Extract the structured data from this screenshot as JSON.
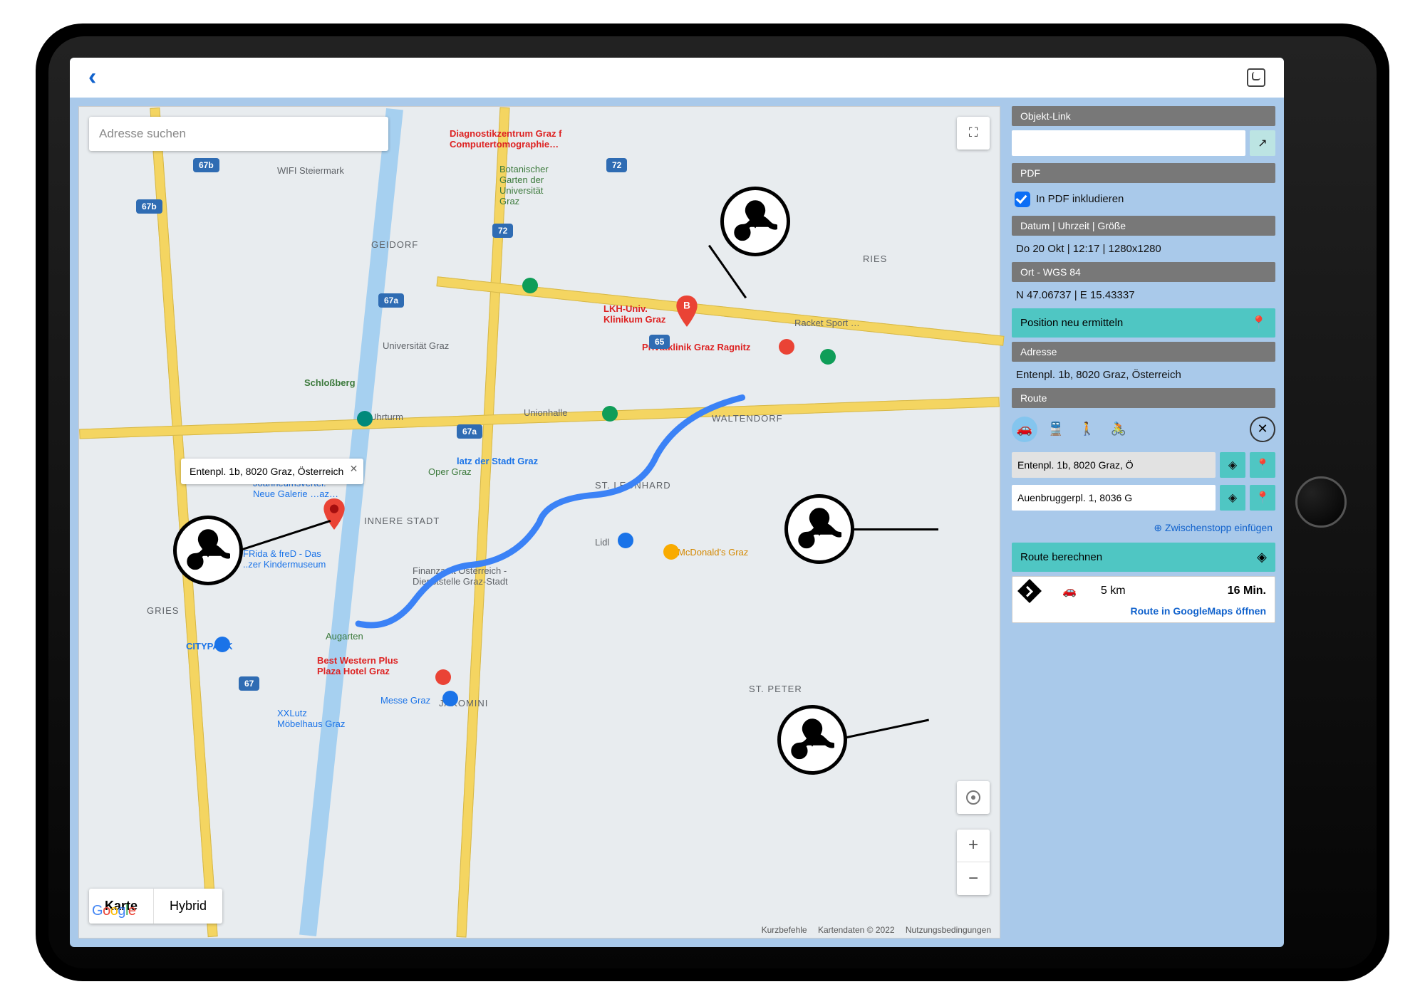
{
  "topbar": {
    "save_tooltip": "Speichern"
  },
  "map": {
    "search_placeholder": "Adresse suchen",
    "type_map": "Karte",
    "type_hybrid": "Hybrid",
    "callout_address": "Entenpl. 1b, 8020 Graz, Österreich",
    "marker_b_label": "B",
    "credits": {
      "shortcuts": "Kurzbefehle",
      "data": "Kartendaten © 2022",
      "terms": "Nutzungsbedingungen"
    },
    "google": "Google",
    "labels": {
      "diag": "Diagnostikzentrum Graz f\nComputertomographie…",
      "wifi": "WIFI Steiermark",
      "botan": "Botanischer\nGarten der\nUniversität\nGraz",
      "lkh": "LKH-Univ.\nKlinikum Graz",
      "privat": "Privatklinik Graz Ragnitz",
      "racket": "Racket Sport …",
      "waltendorf": "WALTENDORF",
      "geidorf": "GEIDORF",
      "ries": "RIES",
      "gries": "GRIES",
      "jakomini": "JAKOMINI",
      "stpeter": "ST. PETER",
      "stleonhard": "ST. LEONHARD",
      "innerestadt": "INNERE STADT",
      "schlossberg": "Schloßberg",
      "uhrturm": "Uhrturm",
      "univ": "Universität Graz",
      "oper": "Oper Graz",
      "stadtplatz": "latz der Stadt Graz",
      "unionhalle": "Unionhalle",
      "lidl": "Lidl",
      "mcd": "McDonald's Graz",
      "finanz": "Finanzamt Österreich -\nDienststelle Graz-Stadt",
      "museum": "Joanneumsvertel:\nNeue Galerie …az…",
      "frida": "FRida & freD - Das\n..zer Kindermuseum",
      "citypark": "CITYPARK",
      "augarten": "Augarten",
      "messe": "Messe Graz",
      "xxxlutz": "XXLutz\nMöbelhaus Graz",
      "bestwestern": "Best Western Plus\nPlaza Hotel Graz"
    },
    "shields": {
      "a67a": "67a",
      "a67b": "67b",
      "a72": "72",
      "a65": "65",
      "a67": "67"
    }
  },
  "side": {
    "objekt_header": "Objekt-Link",
    "objekt_value": "",
    "open_link_icon": "↗",
    "pdf_header": "PDF",
    "pdf_checkbox_label": "In PDF inkludieren",
    "datetime_header": "Datum | Uhrzeit | Größe",
    "datetime_value": "Do 20 Okt | 12:17 | 1280x1280",
    "location_header": "Ort - WGS 84",
    "location_value": "N 47.06737 | E 15.43337",
    "relocate_btn": "Position neu ermitteln",
    "address_header": "Adresse",
    "address_value": "Entenpl. 1b, 8020 Graz, Österreich",
    "route_header": "Route",
    "mode_car": "car-icon",
    "mode_transit": "transit-icon",
    "mode_walk": "walk-icon",
    "mode_bike": "bike-icon",
    "mode_clear": "clear-icon",
    "start_value": "Entenpl. 1b, 8020 Graz, Ö",
    "end_value": "Auenbruggerpl. 1, 8036 G",
    "add_stop": "⊕ Zwischenstopp einfügen",
    "calc_btn": "Route berechnen",
    "result_distance": "5 km",
    "result_duration": "16 Min.",
    "open_gmaps": "Route in GoogleMaps öffnen"
  }
}
